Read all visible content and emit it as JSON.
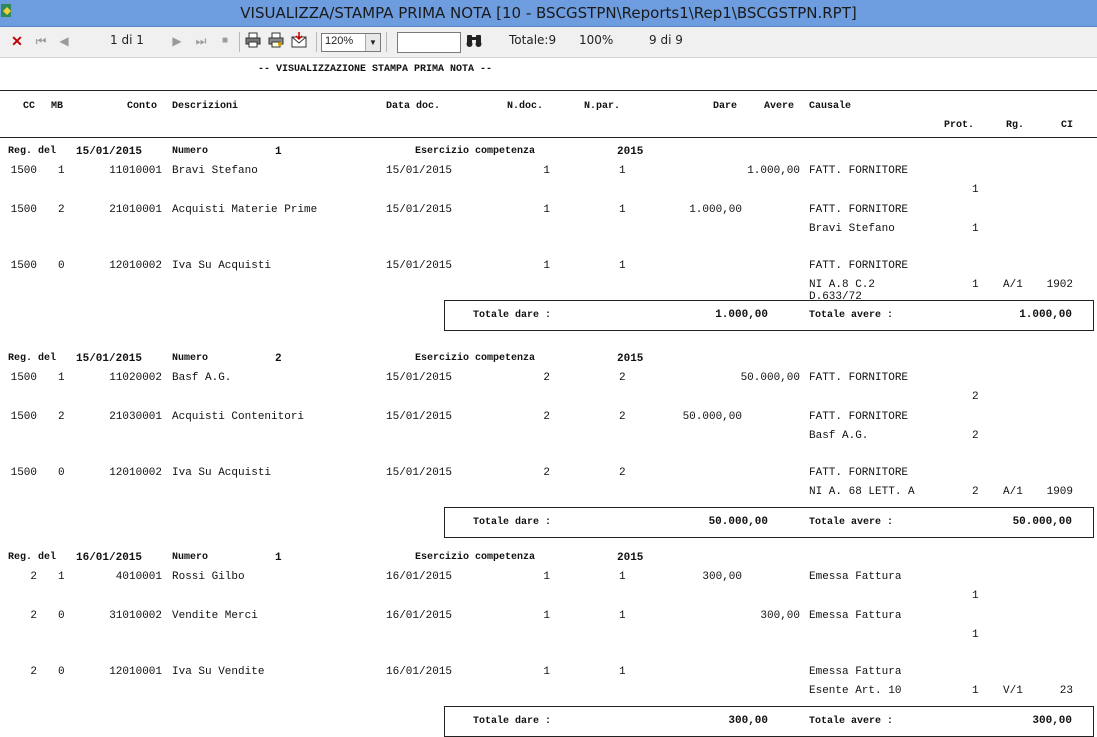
{
  "window": {
    "title": "VISUALIZZA/STAMPA PRIMA NOTA [10 - BSCGSTPN\\Reports1\\Rep1\\BSCGSTPN.RPT]"
  },
  "toolbar": {
    "page_label": "1 di 1",
    "zoom_value": "120%",
    "search_value": "",
    "totale_label": "Totale:9",
    "percent_label": "100%",
    "records_label": "9 di 9"
  },
  "report": {
    "heading": "-- VISUALIZZAZIONE STAMPA PRIMA NOTA --",
    "columns": {
      "cc": "CC",
      "mb": "MB",
      "conto": "Conto",
      "descr": "Descrizioni",
      "data": "Data doc.",
      "ndoc": "N.doc.",
      "npar": "N.par.",
      "dare": "Dare",
      "avere": "Avere",
      "causale": "Causale",
      "prot": "Prot.",
      "rg": "Rg.",
      "ci": "CI"
    },
    "regs": [
      {
        "label": "Reg. del",
        "date": "15/01/2015",
        "numero_label": "Numero",
        "numero": "1",
        "esercizio_label": "Esercizio competenza",
        "anno": "2015",
        "rows": [
          {
            "cc": "1500",
            "mb": "1",
            "conto": "11010001",
            "descr": "Bravi Stefano",
            "data": "15/01/2015",
            "ndoc": "1",
            "npar": "1",
            "dare": "",
            "avere": "1.000,00",
            "causale": "FATT. FORNITORE",
            "causale2": "",
            "causale3": "",
            "prot": "1",
            "rg": "",
            "ci": ""
          },
          {
            "cc": "1500",
            "mb": "2",
            "conto": "21010001",
            "descr": "Acquisti Materie Prime",
            "data": "15/01/2015",
            "ndoc": "1",
            "npar": "1",
            "dare": "1.000,00",
            "avere": "",
            "causale": "FATT. FORNITORE",
            "causale2": "Bravi Stefano",
            "causale3": "",
            "prot": "1",
            "rg": "",
            "ci": ""
          },
          {
            "cc": "1500",
            "mb": "0",
            "conto": "12010002",
            "descr": "Iva Su Acquisti",
            "data": "15/01/2015",
            "ndoc": "1",
            "npar": "1",
            "dare": "",
            "avere": "",
            "causale": "FATT. FORNITORE",
            "causale2": "NI A.8 C.2",
            "causale3": "D.633/72",
            "prot": "1",
            "rg": "A/1",
            "ci": "1902"
          }
        ],
        "tot_dare_label": "Totale dare :",
        "tot_dare": "1.000,00",
        "tot_avere_label": "Totale avere :",
        "tot_avere": "1.000,00"
      },
      {
        "label": "Reg. del",
        "date": "15/01/2015",
        "numero_label": "Numero",
        "numero": "2",
        "esercizio_label": "Esercizio competenza",
        "anno": "2015",
        "rows": [
          {
            "cc": "1500",
            "mb": "1",
            "conto": "11020002",
            "descr": "Basf A.G.",
            "data": "15/01/2015",
            "ndoc": "2",
            "npar": "2",
            "dare": "",
            "avere": "50.000,00",
            "causale": "FATT. FORNITORE",
            "causale2": "",
            "causale3": "",
            "prot": "2",
            "rg": "",
            "ci": ""
          },
          {
            "cc": "1500",
            "mb": "2",
            "conto": "21030001",
            "descr": "Acquisti Contenitori",
            "data": "15/01/2015",
            "ndoc": "2",
            "npar": "2",
            "dare": "50.000,00",
            "avere": "",
            "causale": "FATT. FORNITORE",
            "causale2": "Basf A.G.",
            "causale3": "",
            "prot": "2",
            "rg": "",
            "ci": ""
          },
          {
            "cc": "1500",
            "mb": "0",
            "conto": "12010002",
            "descr": "Iva Su Acquisti",
            "data": "15/01/2015",
            "ndoc": "2",
            "npar": "2",
            "dare": "",
            "avere": "",
            "causale": "FATT. FORNITORE",
            "causale2": "NI A. 68 LETT. A",
            "causale3": "",
            "prot": "2",
            "rg": "A/1",
            "ci": "1909"
          }
        ],
        "tot_dare_label": "Totale dare :",
        "tot_dare": "50.000,00",
        "tot_avere_label": "Totale avere :",
        "tot_avere": "50.000,00"
      },
      {
        "label": "Reg. del",
        "date": "16/01/2015",
        "numero_label": "Numero",
        "numero": "1",
        "esercizio_label": "Esercizio competenza",
        "anno": "2015",
        "rows": [
          {
            "cc": "2",
            "mb": "1",
            "conto": "4010001",
            "descr": "Rossi Gilbo",
            "data": "16/01/2015",
            "ndoc": "1",
            "npar": "1",
            "dare": "300,00",
            "avere": "",
            "causale": "Emessa Fattura",
            "causale2": "",
            "causale3": "",
            "prot": "1",
            "rg": "",
            "ci": ""
          },
          {
            "cc": "2",
            "mb": "0",
            "conto": "31010002",
            "descr": "Vendite Merci",
            "data": "16/01/2015",
            "ndoc": "1",
            "npar": "1",
            "dare": "",
            "avere": "300,00",
            "causale": "Emessa Fattura",
            "causale2": "",
            "causale3": "",
            "prot": "1",
            "rg": "",
            "ci": ""
          },
          {
            "cc": "2",
            "mb": "0",
            "conto": "12010001",
            "descr": "Iva Su Vendite",
            "data": "16/01/2015",
            "ndoc": "1",
            "npar": "1",
            "dare": "",
            "avere": "",
            "causale": "Emessa Fattura",
            "causale2": "Esente Art. 10",
            "causale3": "",
            "prot": "1",
            "rg": "V/1",
            "ci": "23"
          }
        ],
        "tot_dare_label": "Totale dare :",
        "tot_dare": "300,00",
        "tot_avere_label": "Totale avere :",
        "tot_avere": "300,00"
      }
    ]
  }
}
